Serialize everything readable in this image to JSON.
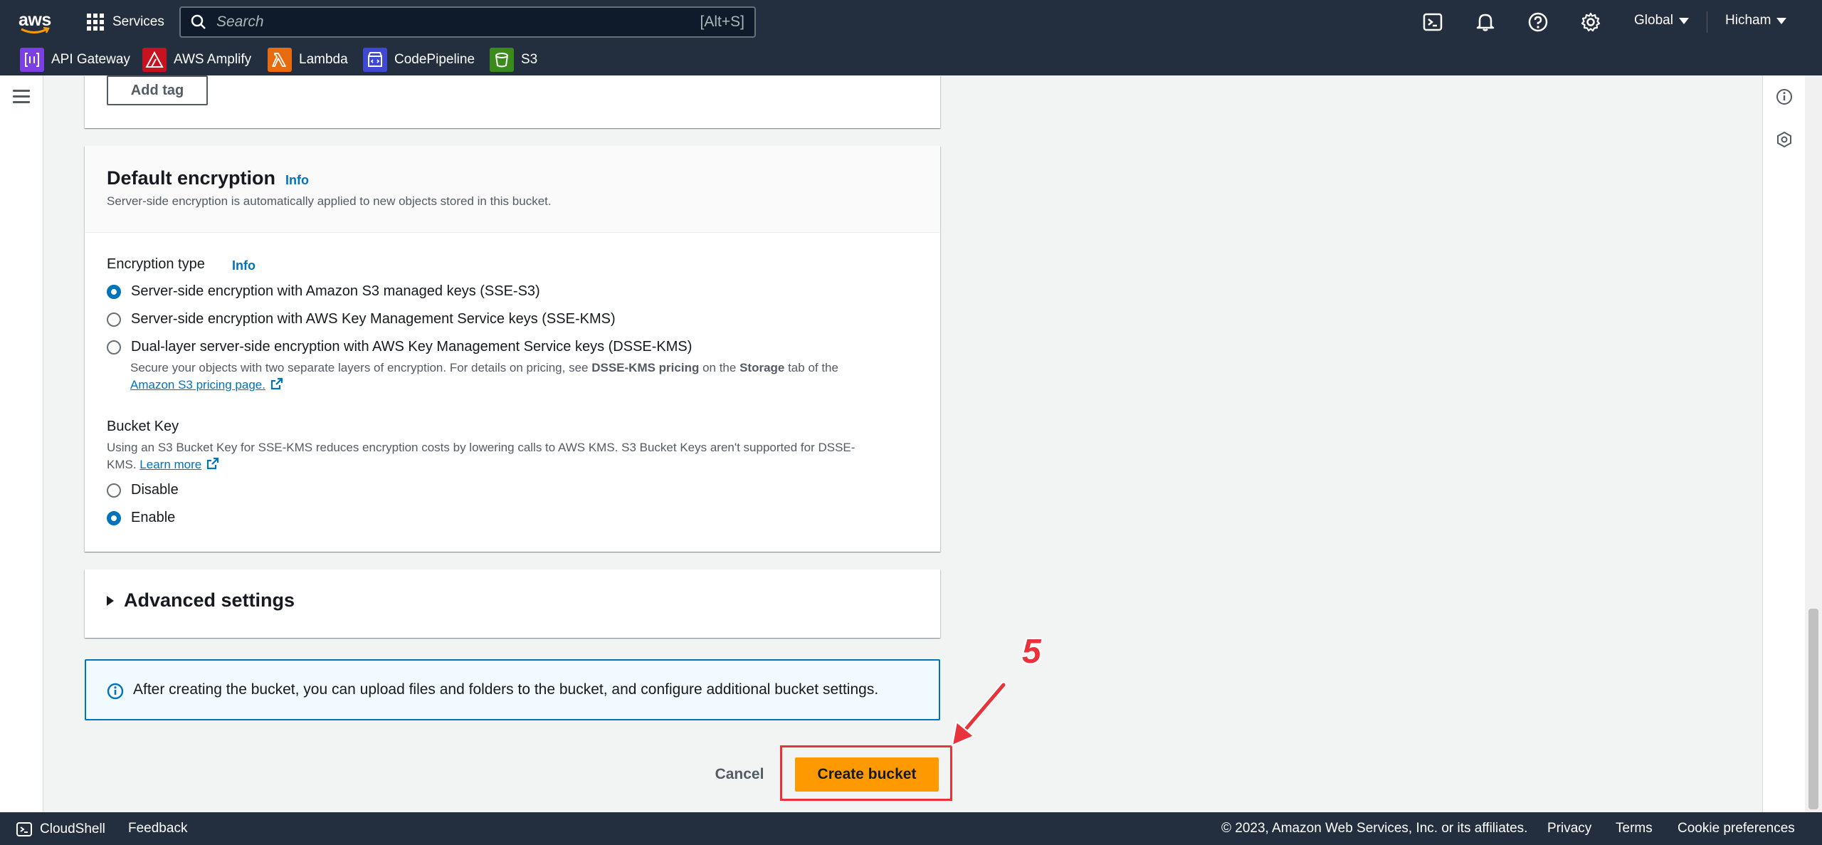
{
  "topnav": {
    "logo": "aws",
    "services_label": "Services",
    "search_placeholder": "Search",
    "search_shortcut": "[Alt+S]",
    "icons": [
      "cloudshell-icon",
      "bell-icon",
      "help-icon",
      "settings-icon"
    ],
    "region": "Global",
    "user": "Hicham"
  },
  "favorites": [
    {
      "label": "API Gateway",
      "icon": "api-gateway-icon",
      "color": "#7b3fe4"
    },
    {
      "label": "AWS Amplify",
      "icon": "amplify-icon",
      "color": "#c7131f"
    },
    {
      "label": "Lambda",
      "icon": "lambda-icon",
      "color": "#e86b0e"
    },
    {
      "label": "CodePipeline",
      "icon": "codepipeline-icon",
      "color": "#3f49d4"
    },
    {
      "label": "S3",
      "icon": "s3-icon",
      "color": "#3b8a1c"
    }
  ],
  "tags": {
    "add_tag_label": "Add tag"
  },
  "encryption": {
    "title": "Default encryption",
    "info": "Info",
    "description": "Server-side encryption is automatically applied to new objects stored in this bucket.",
    "type_label": "Encryption type",
    "type_info": "Info",
    "options": [
      {
        "label": "Server-side encryption with Amazon S3 managed keys (SSE-S3)",
        "checked": true
      },
      {
        "label": "Server-side encryption with AWS Key Management Service keys (SSE-KMS)",
        "checked": false
      },
      {
        "label": "Dual-layer server-side encryption with AWS Key Management Service keys (DSSE-KMS)",
        "checked": false
      }
    ],
    "dsse_help_1": "Secure your objects with two separate layers of encryption. For details on pricing, see ",
    "dsse_help_bold1": "DSSE-KMS pricing",
    "dsse_help_2": " on the ",
    "dsse_help_bold2": "Storage",
    "dsse_help_3": " tab of the",
    "dsse_help_link": "Amazon S3 pricing page.",
    "bucket_key_label": "Bucket Key",
    "bucket_key_help_1": "Using an S3 Bucket Key for SSE-KMS reduces encryption costs by lowering calls to AWS KMS. S3 Bucket Keys aren't supported for DSSE-",
    "bucket_key_help_2": "KMS.",
    "bucket_key_link": "Learn more",
    "bucket_key_options": [
      {
        "label": "Disable",
        "checked": false
      },
      {
        "label": "Enable",
        "checked": true
      }
    ]
  },
  "advanced": {
    "label": "Advanced settings"
  },
  "alert": {
    "text": "After creating the bucket, you can upload files and folders to the bucket, and configure additional bucket settings."
  },
  "actions": {
    "cancel": "Cancel",
    "create": "Create bucket"
  },
  "annotation": {
    "step": "5",
    "color": "#e8333a"
  },
  "footer": {
    "cloudshell": "CloudShell",
    "feedback": "Feedback",
    "copyright": "© 2023, Amazon Web Services, Inc. or its affiliates.",
    "privacy": "Privacy",
    "terms": "Terms",
    "cookies": "Cookie preferences"
  },
  "colors": {
    "nav_bg": "#232f3e",
    "primary": "#ff9900",
    "link": "#0073bb"
  }
}
